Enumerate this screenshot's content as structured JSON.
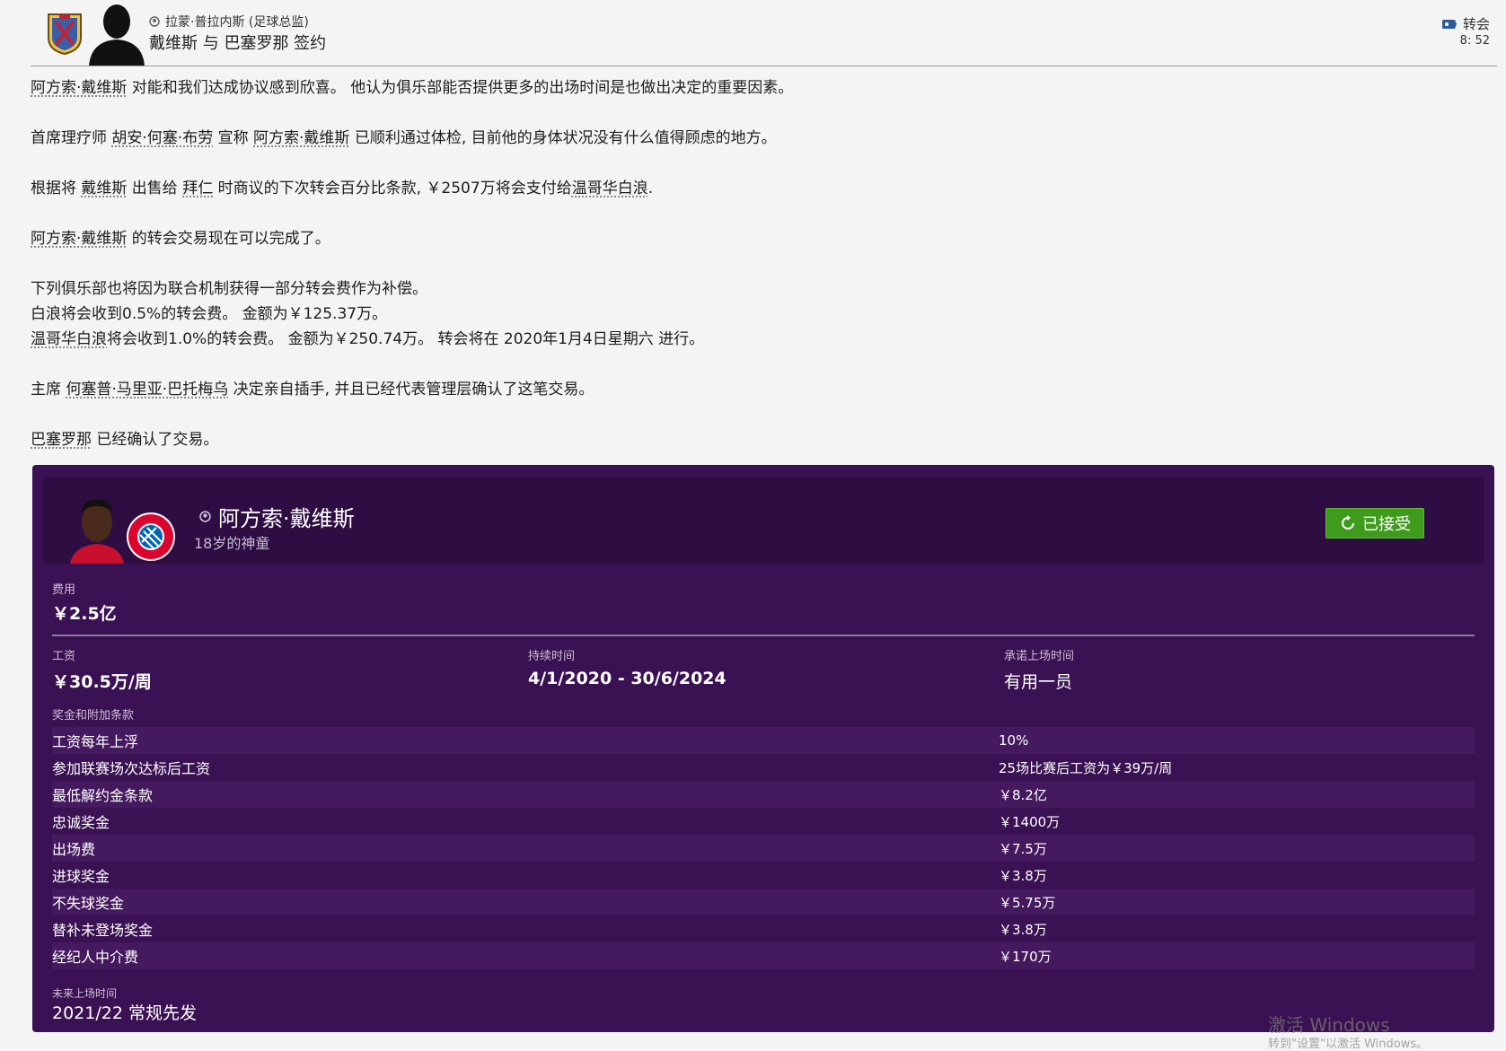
{
  "header": {
    "sender": "拉蒙·普拉内斯 (足球总监)",
    "subject": "戴维斯 与 巴塞罗那 签约",
    "category": "转会",
    "time": "8: 52"
  },
  "message": {
    "p1": {
      "a": "阿方索·戴维斯",
      "b": " 对能和我们达成协议感到欣喜。 他认为俱乐部能否提供更多的出场时间是也做出决定的重要因素。"
    },
    "p2": {
      "a": "首席理疗师 ",
      "b": "胡安·何塞·布劳",
      "c": " 宣称 ",
      "d": "阿方索·戴维斯",
      "e": " 已顺利通过体检, 目前他的身体状况没有什么值得顾虑的地方。"
    },
    "p3": {
      "a": "根据将 ",
      "b": "戴维斯",
      "c": " 出售给 ",
      "d": "拜仁",
      "e": " 时商议的下次转会百分比条款, ￥2507万将会支付给",
      "f": "温哥华白浪",
      "g": "."
    },
    "p4": {
      "a": "阿方索·戴维斯",
      "b": " 的转会交易现在可以完成了。"
    },
    "p5": {
      "line1": "下列俱乐部也将因为联合机制获得一部分转会费作为补偿。",
      "line2": "白浪将会收到0.5%的转会费。 金额为￥125.37万。",
      "line3a": "温哥华白浪",
      "line3b": "将会收到1.0%的转会费。 金额为￥250.74万。 转会将在 2020年1月4日星期六 进行。"
    },
    "p6": {
      "a": "主席 ",
      "b": "何塞普·马里亚·巴托梅乌",
      "c": " 决定亲自插手, 并且已经代表管理层确认了这笔交易。"
    },
    "p7": {
      "a": "巴塞罗那",
      "b": " 已经确认了交易。"
    }
  },
  "card": {
    "player_name": "阿方索·戴维斯",
    "player_desc": "18岁的神童",
    "status": "已接受",
    "fee_label": "费用",
    "fee_value": "￥2.5亿",
    "wage_label": "工资",
    "wage_value": "￥30.5万/周",
    "duration_label": "持续时间",
    "duration_value": "4/1/2020 - 30/6/2024",
    "playtime_label": "承诺上场时间",
    "playtime_value": "有用一员",
    "bonus_title": "奖金和附加条款",
    "bonuses": [
      {
        "name": "工资每年上浮",
        "value": "10%"
      },
      {
        "name": "参加联赛场次达标后工资",
        "value": "25场比赛后工资为￥39万/周"
      },
      {
        "name": "最低解约金条款",
        "value": "￥8.2亿"
      },
      {
        "name": "忠诚奖金",
        "value": "￥1400万"
      },
      {
        "name": "出场费",
        "value": "￥7.5万"
      },
      {
        "name": "进球奖金",
        "value": "￥3.8万"
      },
      {
        "name": "不失球奖金",
        "value": "￥5.75万"
      },
      {
        "name": "替补未登场奖金",
        "value": "￥3.8万"
      },
      {
        "name": "经纪人中介费",
        "value": "￥170万"
      }
    ],
    "future_label": "未来上场时间",
    "future_value": "2021/22   常规先发"
  },
  "watermark": {
    "title": "激活 Windows",
    "sub": "转到\"设置\"以激活 Windows。"
  },
  "colors": {
    "card_bg": "#3a1152",
    "card_head_bg": "#2e0d42",
    "accept_green": "#3e9b1c",
    "page_bg": "#f4f4f4"
  }
}
